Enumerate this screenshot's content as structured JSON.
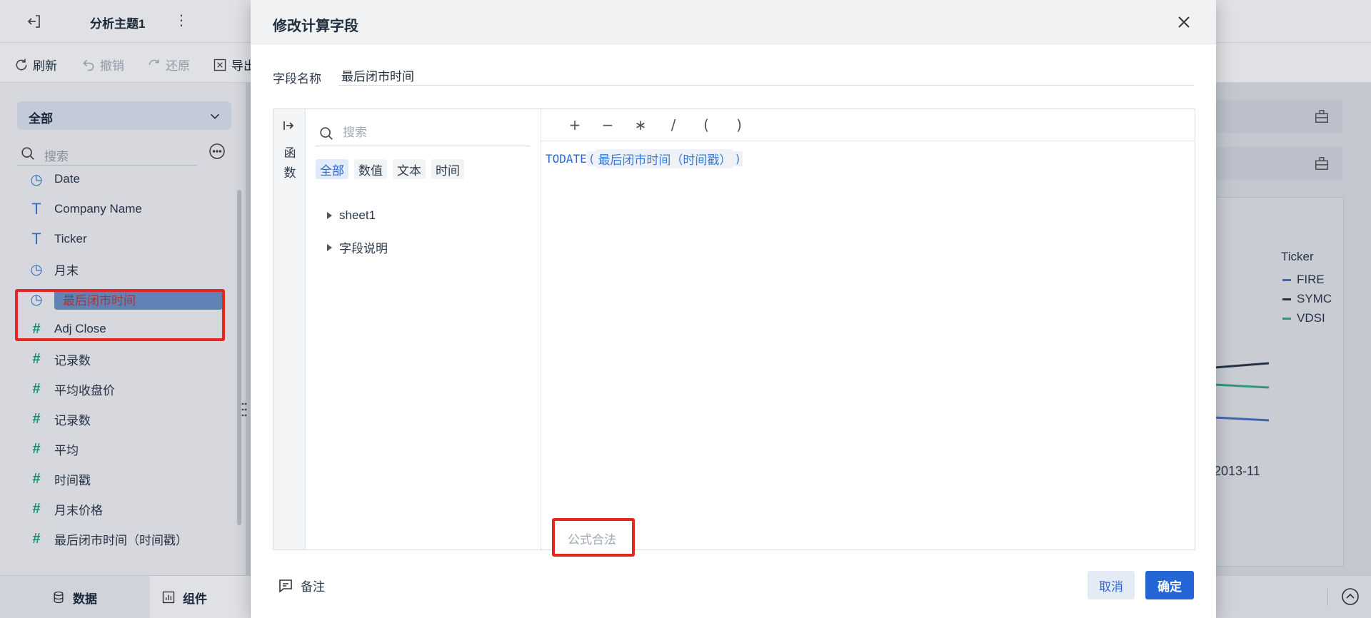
{
  "app": {
    "title": "分析主题1",
    "more_icon": "vertical-dots-icon"
  },
  "toolbar": {
    "refresh": "刷新",
    "undo": "撤销",
    "redo": "还原",
    "export": "导出"
  },
  "left_panel": {
    "dropdown_value": "全部",
    "search_placeholder": "搜索",
    "fields": [
      {
        "label": "Date",
        "type": "date"
      },
      {
        "label": "Company Name",
        "type": "text"
      },
      {
        "label": "Ticker",
        "type": "text"
      },
      {
        "label": "月末",
        "type": "date-calc"
      },
      {
        "label": "最后闭市时间",
        "type": "date-calc",
        "selected": true
      },
      {
        "label": "Adj Close",
        "type": "number"
      },
      {
        "label": "记录数",
        "type": "number"
      },
      {
        "label": "平均收盘价",
        "type": "number"
      },
      {
        "label": "记录数",
        "type": "number-calc"
      },
      {
        "label": "平均",
        "type": "number-calc"
      },
      {
        "label": "时间戳",
        "type": "number-calc"
      },
      {
        "label": "月末价格",
        "type": "number-calc"
      },
      {
        "label": "最后闭市时间（时间戳）",
        "type": "number-calc"
      }
    ]
  },
  "bottom_tabs": {
    "data": "数据",
    "components": "组件"
  },
  "chart_legend": {
    "title": "Ticker",
    "items": [
      {
        "name": "FIRE",
        "color": "#4a72c8"
      },
      {
        "name": "SYMC",
        "color": "#2c3a4b"
      },
      {
        "name": "VDSI",
        "color": "#3aa88f"
      }
    ],
    "axis_tick": "2013-11"
  },
  "modal": {
    "title": "修改计算字段",
    "field_name_label": "字段名称",
    "field_name_value": "最后闭市时间",
    "function_rail_label": "函数",
    "function_search_placeholder": "搜索",
    "categories": [
      "全部",
      "数值",
      "文本",
      "时间"
    ],
    "tree": [
      "sheet1",
      "字段说明"
    ],
    "operators": [
      "+",
      "−",
      "∗",
      "/",
      "(",
      ")"
    ],
    "formula": {
      "function_name": "TODATE",
      "open_paren": "(",
      "argument": "最后闭市时间（时间戳）",
      "close_paren": ")"
    },
    "status": "公式合法",
    "note_label": "备注",
    "cancel_label": "取消",
    "ok_label": "确定"
  },
  "colors": {
    "primary": "#2566d6",
    "highlight_red": "#e5261f"
  }
}
